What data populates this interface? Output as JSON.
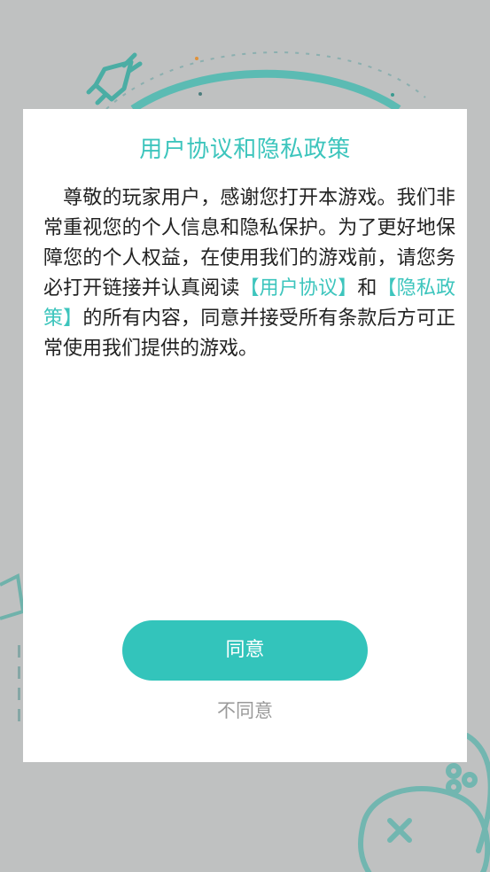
{
  "dialog": {
    "title": "用户协议和隐私政策",
    "content": {
      "text_1": "尊敬的玩家用户，感谢您打开本游戏。我们非常重视您的个人信息和隐私保护。为了更好地保障您的个人权益，在使用我们的游戏前，请您务必打开链接并认真阅读",
      "user_agreement_link": "【用户协议】",
      "text_2": "和",
      "privacy_policy_link": "【隐私政策】",
      "text_3": "的所有内容，同意并接受所有条款后方可正常使用我们提供的游戏。"
    },
    "agree_label": "同意",
    "disagree_label": "不同意"
  },
  "colors": {
    "accent": "#33c4bb",
    "title": "#3dc5bd",
    "overlay_background": "#bfc1c1",
    "body_text": "#222222",
    "secondary_text": "#9a9a9a"
  },
  "background_icons": [
    "rocket-icon",
    "gamepad-icon"
  ]
}
